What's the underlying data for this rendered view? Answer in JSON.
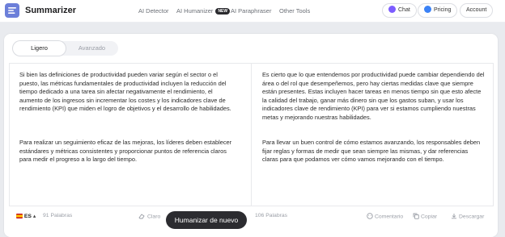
{
  "brand": {
    "name": "Summarizer"
  },
  "nav": {
    "ai_detector": "AI Detector",
    "ai_humanizer": "AI Humanizer",
    "ai_humanizer_badge": "NEW",
    "ai_paraphraser": "AI Paraphraser",
    "other_tools": "Other Tools"
  },
  "actions": {
    "chat": "Chat",
    "pricing": "Pricing",
    "account": "Account"
  },
  "colors": {
    "logo": "#6c7fd9",
    "chat_dot": "#7c5cff",
    "pricing_dot": "#3b82f6",
    "button": "#2c2c30"
  },
  "modes": {
    "light": "Ligero",
    "advanced": "Avanzado"
  },
  "input": {
    "paragraphs": [
      "Si bien las definiciones de productividad pueden variar según el sector o el puesto, las métricas fundamentales de productividad incluyen la reducción del tiempo dedicado a una tarea sin afectar negativamente el rendimiento, el aumento de los ingresos sin incrementar los costes y los indicadores clave de rendimiento (KPI) que miden el logro de objetivos y el desarrollo de habilidades.",
      "Para realizar un seguimiento eficaz de las mejoras, los líderes deben establecer estándares y métricas consistentes y proporcionar puntos de referencia claros para medir el progreso a lo largo del tiempo."
    ],
    "language": "ES",
    "word_count": "91 Palabras",
    "clear": "Claro"
  },
  "humanize_button": "Humanizar de nuevo",
  "output": {
    "paragraphs": [
      "Es cierto que lo que entendemos por productividad puede cambiar dependiendo del área o del rol que desempeñemos, pero hay ciertas medidas clave que siempre están presentes. Estas incluyen hacer tareas en menos tiempo sin que esto afecte la calidad del trabajo, ganar más dinero sin que los gastos suban, y usar los indicadores clave de rendimiento (KPI) para ver si estamos cumpliendo nuestras metas y mejorando nuestras habilidades.",
      "Para llevar un buen control de cómo estamos avanzando, los responsables deben fijar reglas y formas de medir que sean siempre las mismas, y dar referencias claras para que podamos ver cómo vamos mejorando con el tiempo."
    ],
    "word_count": "106 Palabras",
    "comment": "Comentario",
    "copy": "Copiar",
    "download": "Descargar"
  }
}
